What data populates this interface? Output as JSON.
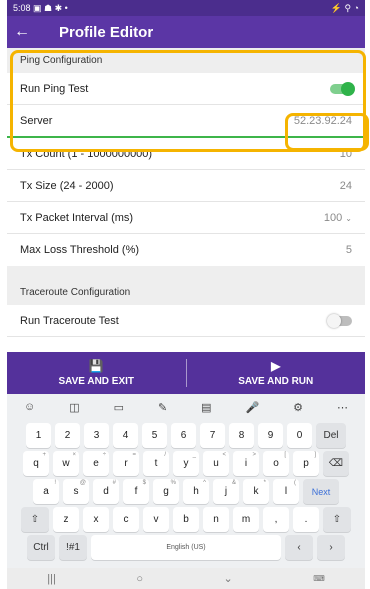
{
  "status": {
    "time": "5:08",
    "left_icons": "▣ ☗ ✱ •",
    "right_icons": "⚡ ⚲ ◔"
  },
  "appbar": {
    "title": "Profile Editor"
  },
  "ping": {
    "header": "Ping Configuration",
    "run_label": "Run Ping Test",
    "server_label": "Server",
    "server_value": "52.23.92.24",
    "tx_count_label": "Tx Count (1 - 1000000000)",
    "tx_count_value": "10",
    "tx_size_label": "Tx Size (24 - 2000)",
    "tx_size_value": "24",
    "interval_label": "Tx Packet Interval (ms)",
    "interval_value": "100",
    "loss_label": "Max Loss Threshold (%)",
    "loss_value": "5"
  },
  "traceroute": {
    "header": "Traceroute Configuration",
    "run_label": "Run Traceroute Test"
  },
  "actions": {
    "save_exit": "SAVE AND EXIT",
    "save_run": "SAVE AND RUN"
  },
  "keyboard": {
    "row1": [
      "1",
      "2",
      "3",
      "4",
      "5",
      "6",
      "7",
      "8",
      "9",
      "0",
      "Del"
    ],
    "row2": [
      "q",
      "w",
      "e",
      "r",
      "t",
      "y",
      "u",
      "i",
      "o",
      "p"
    ],
    "row2_hints": [
      "+",
      "×",
      "÷",
      "=",
      "/",
      "_",
      "<",
      ">",
      "[",
      "]"
    ],
    "row3": [
      "a",
      "s",
      "d",
      "f",
      "g",
      "h",
      "j",
      "k",
      "l"
    ],
    "row3_hints": [
      "!",
      "@",
      "#",
      "$",
      "%",
      "^",
      "&",
      "*",
      "("
    ],
    "next": "Next",
    "row4": [
      "z",
      "x",
      "c",
      "v",
      "b",
      "n",
      "m",
      ",",
      "."
    ],
    "ctrl": "Ctrl",
    "sym": "!#1",
    "space": "English (US)"
  },
  "colors": {
    "statusbar": "#4b2d8d",
    "appbar": "#5b36a5",
    "actionbar": "#54319b",
    "accent_green": "#2fb34a",
    "highlight": "#f5b400"
  }
}
